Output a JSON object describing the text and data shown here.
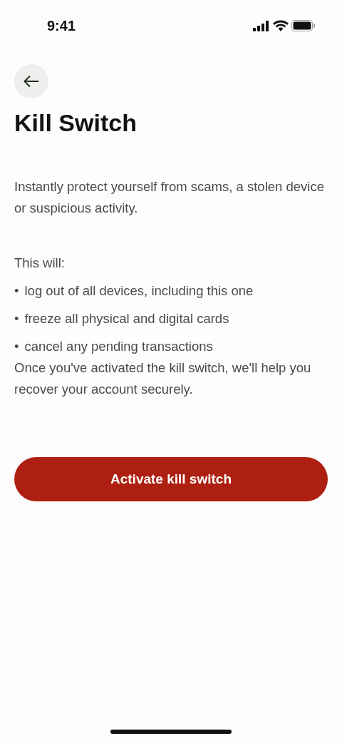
{
  "status_bar": {
    "time": "9:41"
  },
  "title": "Kill Switch",
  "intro": "Instantly protect yourself from scams, a stolen device or suspicious activity.",
  "list_heading": "This will:",
  "items": [
    {
      "bullet": "•",
      "text": "log out of all devices, including this one"
    },
    {
      "bullet": "•",
      "text": "freeze all physical and digital cards"
    },
    {
      "bullet": "•",
      "text": "cancel any pending transactions"
    }
  ],
  "outro": "Once you've activated the kill switch, we'll help you recover your account securely.",
  "button": {
    "label": "Activate kill switch"
  }
}
